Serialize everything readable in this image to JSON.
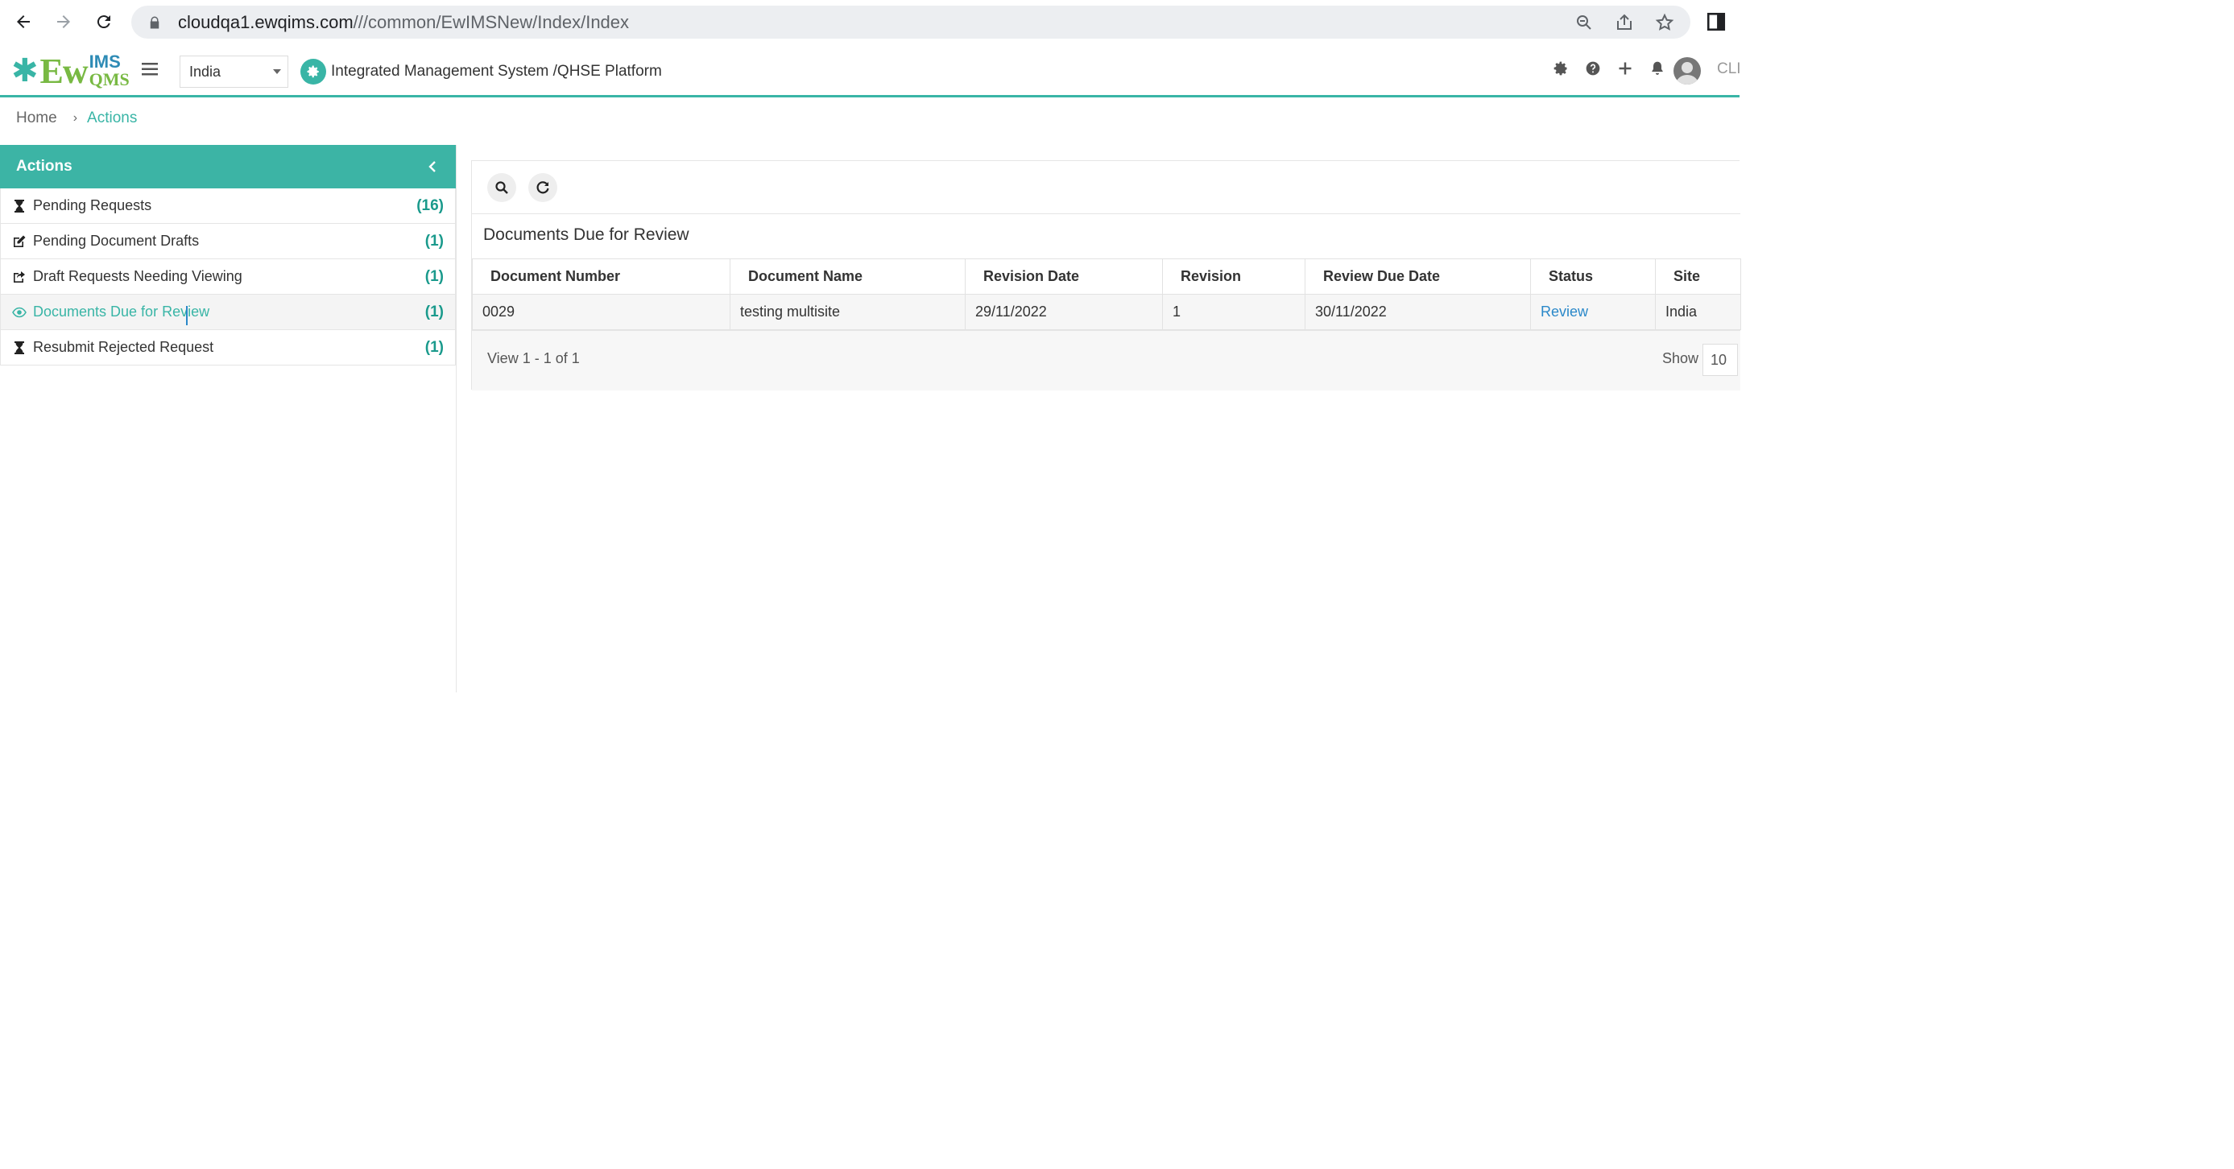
{
  "browser": {
    "url_host": "cloudqa1.ewqims.com",
    "url_path": "///common/EwIMSNew/Index/Index"
  },
  "header": {
    "logo_ew": "Ew",
    "logo_ims": "IMS",
    "logo_qms": "QMS",
    "site": "India",
    "platform_title": "Integrated Management System /QHSE Platform",
    "user_cut": "CLI"
  },
  "breadcrumb": {
    "home": "Home",
    "current": "Actions"
  },
  "left_panel": {
    "title": "Actions",
    "items": [
      {
        "label": "Pending Requests",
        "count": "(16)",
        "icon": "hourglass-icon"
      },
      {
        "label": "Pending Document Drafts",
        "count": "(1)",
        "icon": "edit-icon"
      },
      {
        "label": "Draft Requests Needing Viewing",
        "count": "(1)",
        "icon": "share-icon"
      },
      {
        "label": "Documents Due for Review",
        "count": "(1)",
        "icon": "eye-icon",
        "active": true
      },
      {
        "label": "Resubmit Rejected Request",
        "count": "(1)",
        "icon": "hourglass-icon"
      }
    ]
  },
  "grid": {
    "title": "Documents Due for Review",
    "columns": [
      "Document Number",
      "Document Name",
      "Revision Date",
      "Revision",
      "Review Due Date",
      "Status",
      "Site"
    ],
    "rows": [
      [
        "0029",
        "testing multisite",
        "29/11/2022",
        "1",
        "30/11/2022",
        "Review",
        "India"
      ]
    ],
    "view_text": "View 1 - 1 of 1",
    "show_label": "Show",
    "page_size": "10"
  },
  "colors": {
    "accent": "#39b5a6",
    "link": "#2a88c9",
    "logo_green": "#78b943"
  }
}
